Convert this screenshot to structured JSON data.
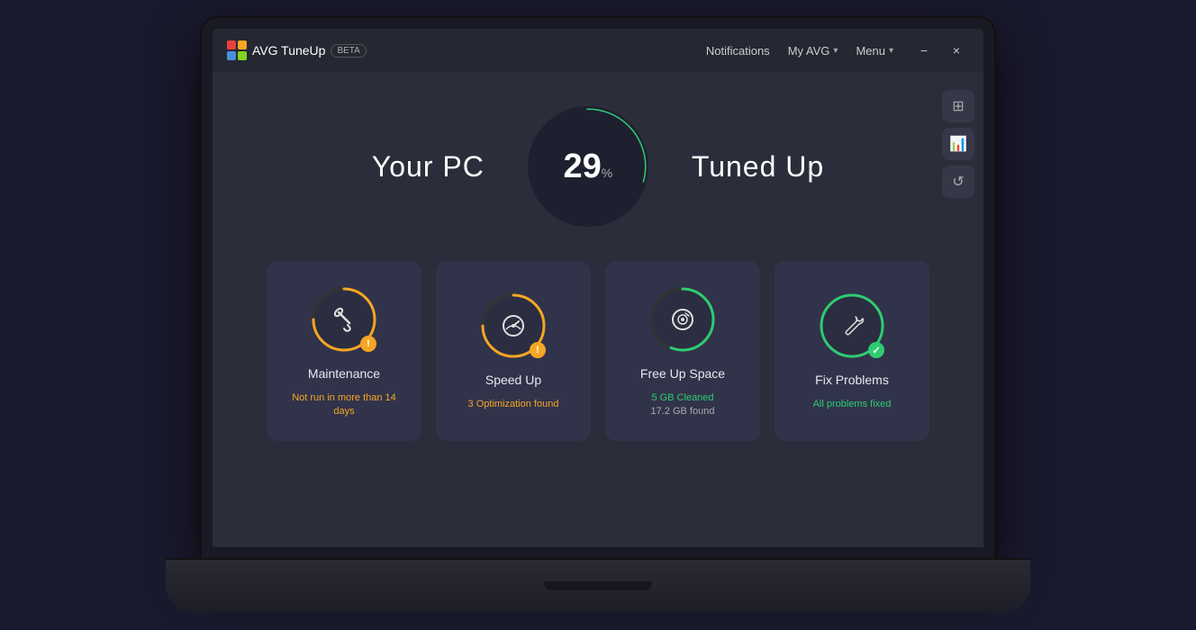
{
  "app": {
    "title": "AVG TuneUp",
    "beta_label": "BETA"
  },
  "titlebar": {
    "notifications": "Notifications",
    "my_avg": "My AVG",
    "menu": "Menu",
    "minimize_label": "−",
    "close_label": "×"
  },
  "score": {
    "prefix": "Your PC",
    "number": "29",
    "percent_symbol": "%",
    "suffix": "Tuned Up",
    "arc_pct": 29
  },
  "cards": [
    {
      "id": "maintenance",
      "title": "Maintenance",
      "subtitle": "Not run in more than 14 days",
      "subtitle_class": "warning",
      "badge_type": "warning",
      "badge_symbol": "!",
      "ring_color": "#f5a623",
      "icon": "🧹"
    },
    {
      "id": "speedup",
      "title": "Speed Up",
      "subtitle": "3 Optimization found",
      "subtitle_class": "warning",
      "badge_type": "warning",
      "badge_symbol": "!",
      "ring_color": "#f5a623",
      "icon": "⚡"
    },
    {
      "id": "freespace",
      "title": "Free Up Space",
      "subtitle_line1": "5 GB Cleaned",
      "subtitle_line2": "17.2 GB found",
      "subtitle_class": "info",
      "badge_type": "none",
      "ring_color": "#2ecc71",
      "icon": "💿"
    },
    {
      "id": "fixproblems",
      "title": "Fix Problems",
      "subtitle": "All problems fixed",
      "subtitle_class": "success",
      "badge_type": "success",
      "badge_symbol": "✓",
      "ring_color": "#2ecc71",
      "icon": "🔧"
    }
  ],
  "sidebar": {
    "icon1": "⊞",
    "icon2": "📊",
    "icon3": "↺"
  }
}
